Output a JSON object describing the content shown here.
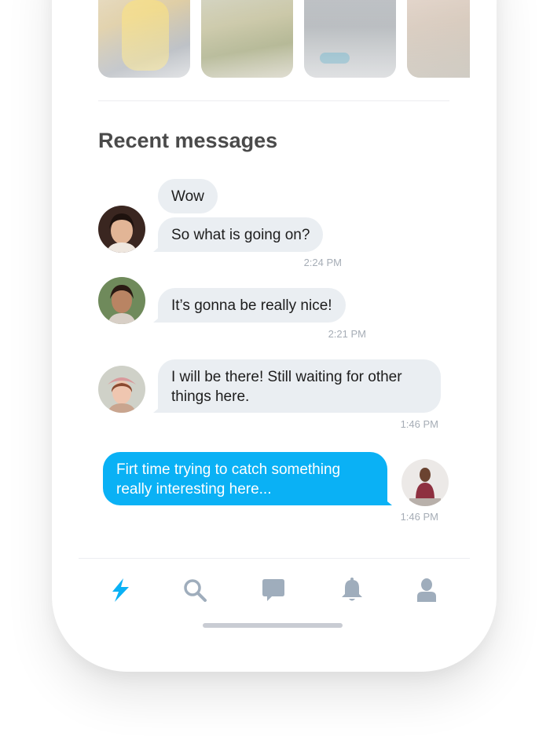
{
  "recent_messages": {
    "title": "Recent messages"
  },
  "messages": [
    {
      "sender": "contact-1",
      "bubbles": [
        "Wow",
        "So what is going on?"
      ],
      "time": "2:24 PM"
    },
    {
      "sender": "contact-2",
      "bubbles": [
        "It’s gonna be really nice!"
      ],
      "time": "2:21 PM"
    },
    {
      "sender": "contact-3",
      "bubbles": [
        "I will be there! Still waiting for other things here."
      ],
      "time": "1:46 PM"
    },
    {
      "sender": "me",
      "bubbles": [
        "Firt time trying to catch something really interesting here..."
      ],
      "time": "1:46 PM"
    }
  ],
  "tabbar": {
    "items": [
      {
        "icon": "lightning-icon",
        "active": true
      },
      {
        "icon": "search-icon",
        "active": false
      },
      {
        "icon": "chat-bubble-icon",
        "active": false
      },
      {
        "icon": "bell-icon",
        "active": false
      },
      {
        "icon": "user-icon",
        "active": false
      }
    ]
  },
  "colors": {
    "accent": "#0ab1f5",
    "bubble_other": "#eaeef2",
    "icon_inactive": "#9fadbc",
    "title_text": "#4a4a4a",
    "timestamp": "#a6adb6"
  }
}
